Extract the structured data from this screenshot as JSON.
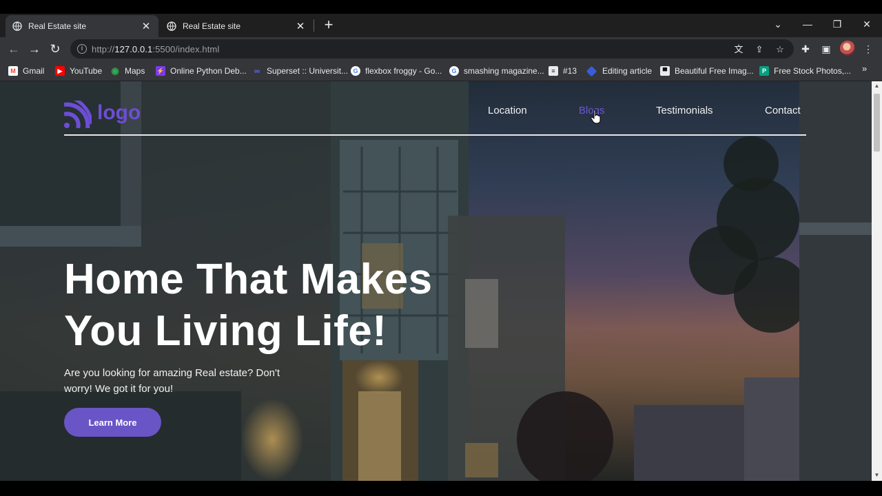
{
  "browser": {
    "tabs": [
      {
        "title": "Real Estate site",
        "active": true
      },
      {
        "title": "Real Estate site",
        "active": false
      }
    ],
    "url": "http://127.0.0.1:5500/index.html",
    "url_host": "127.0.0.1",
    "url_scheme": "http://",
    "url_rest": ":5500/index.html",
    "bookmarks": [
      {
        "label": "Gmail",
        "icon": "gmail-icon",
        "color": "#ea4335"
      },
      {
        "label": "YouTube",
        "icon": "youtube-icon",
        "color": "#ff0000"
      },
      {
        "label": "Maps",
        "icon": "maps-icon",
        "color": "#34a853"
      },
      {
        "label": "Online Python Deb...",
        "icon": "bolt-icon",
        "color": "#7c3aed"
      },
      {
        "label": "Superset :: Universit...",
        "icon": "superset-icon",
        "color": "#4f46e5"
      },
      {
        "label": "flexbox froggy - Go...",
        "icon": "google-icon",
        "color": "#ffffff"
      },
      {
        "label": "smashing magazine...",
        "icon": "google-icon",
        "color": "#ffffff"
      },
      {
        "label": "#13",
        "icon": "page-icon",
        "color": "#e8eaed"
      },
      {
        "label": "Editing article",
        "icon": "editing-icon",
        "color": "#3b82f6"
      },
      {
        "label": "Beautiful Free Imag...",
        "icon": "unsplash-icon",
        "color": "#111111"
      },
      {
        "label": "Free Stock Photos,...",
        "icon": "pexels-icon",
        "color": "#05a081"
      }
    ]
  },
  "site": {
    "logo_text": "logo",
    "nav": [
      {
        "label": "Location"
      },
      {
        "label": "Blogs",
        "hovered": true
      },
      {
        "label": "Testimonials"
      },
      {
        "label": "Contact"
      }
    ],
    "hero": {
      "title_line1": "Home That Makes",
      "title_line2": "You Living Life!",
      "subtitle": "Are you looking for amazing Real estate? Don't worry! We got it for you!",
      "cta": "Learn More"
    },
    "colors": {
      "accent": "#6a55c7",
      "nav_hover": "#6d56d8"
    }
  }
}
